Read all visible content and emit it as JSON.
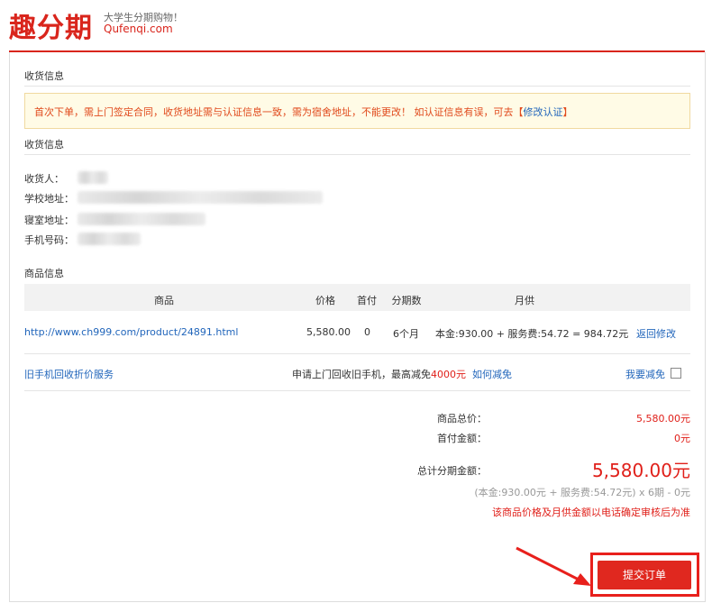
{
  "brand": {
    "logo": "趣分期",
    "slogan": "大学生分期购物！",
    "domain": "Qufenqi.com"
  },
  "shipping_section_title": "收货信息",
  "notice": {
    "text": "首次下单，需上门签定合同，收货地址需与认证信息一致，需为宿舍地址，不能更改！ 如认证信息有误，可去【",
    "link": "修改认证",
    "suffix": "】"
  },
  "shipping_info_title": "收货信息",
  "fields": {
    "receiver": "收货人：",
    "school": "学校地址：",
    "dorm": "寝室地址：",
    "phone": "手机号码："
  },
  "product_section_title": "商品信息",
  "table": {
    "headers": [
      "商品",
      "价格",
      "首付",
      "分期数",
      "月供"
    ],
    "row": {
      "url": "http://www.ch999.com/product/24891.html",
      "price": "5,580.00",
      "down_payment": "0",
      "installments": "6个月",
      "monthly": "本金:930.00 + 服务费:54.72 = 984.72元",
      "action": "返回修改"
    }
  },
  "tradein": {
    "link": "旧手机回收折价服务",
    "text": "申请上门回收旧手机，最高减免",
    "amount": "4000元",
    "how": "如何减免",
    "opt": "我要减免"
  },
  "summary": {
    "total_label": "商品总价：",
    "total_value": "5,580.00元",
    "down_label": "首付金额：",
    "down_value": "0元",
    "finance_label": "总计分期金额：",
    "finance_value": "5,580.00元",
    "breakdown": "(本金:930.00元 + 服务费:54.72元) x 6期 - 0元",
    "disclaimer": "该商品价格及月供金额以电话确定审核后为准"
  },
  "submit_label": "提交订单",
  "colors": {
    "brand_red": "#d9251c",
    "link_blue": "#2266bb"
  }
}
